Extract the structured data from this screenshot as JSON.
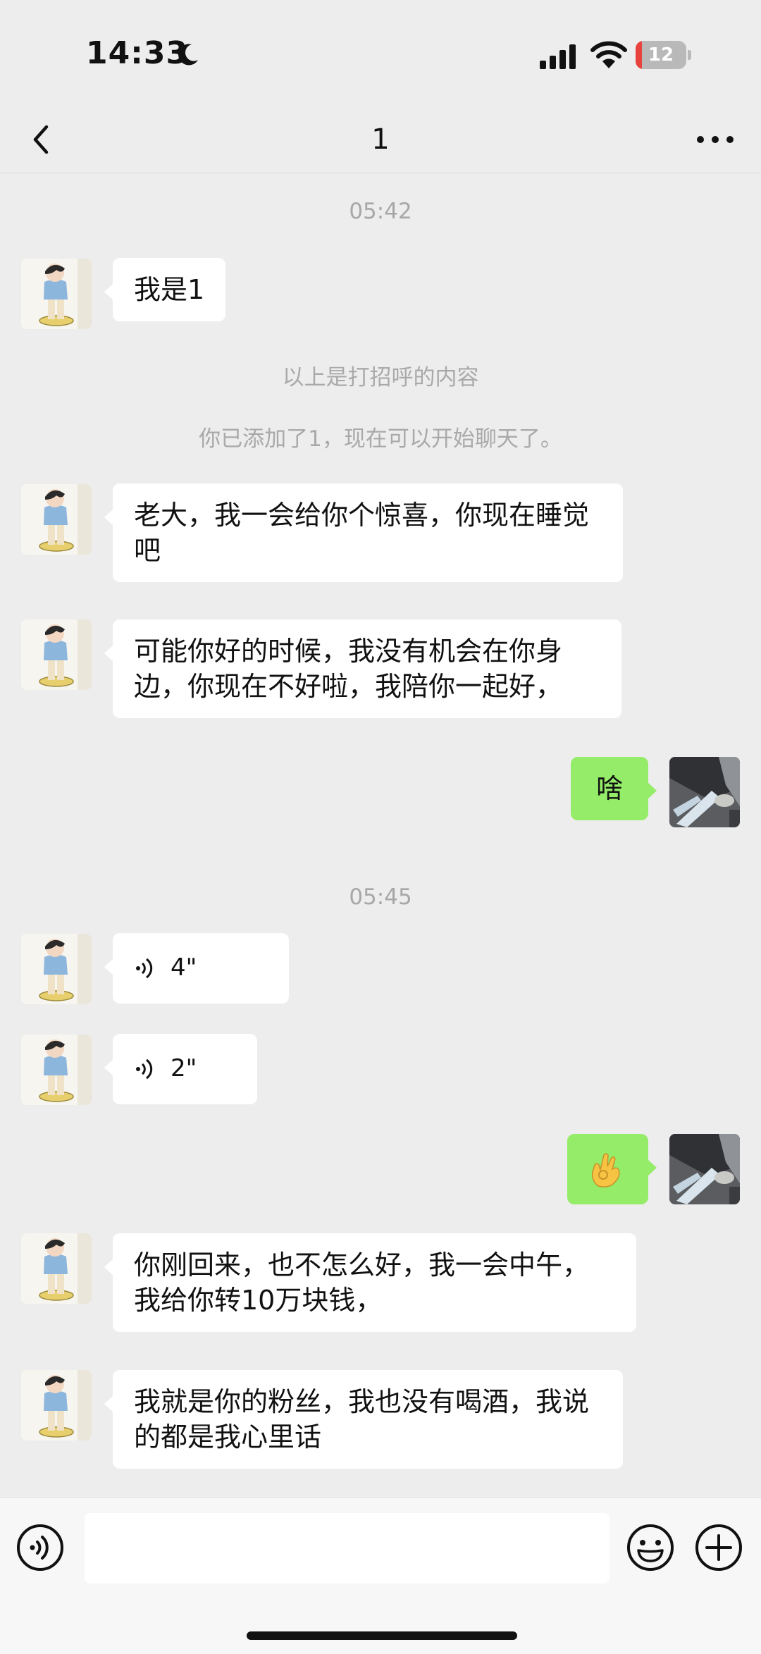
{
  "status_bar": {
    "time": "14:33",
    "battery": "12",
    "battery_level": 0.12
  },
  "nav": {
    "title": "1"
  },
  "chat": {
    "time_1": "05:42",
    "msg_1": "我是1",
    "note_1": "以上是打招呼的内容",
    "note_2": "你已添加了1，现在可以开始聊天了。",
    "msg_2": "老大，我一会给你个惊喜，你现在睡觉吧",
    "msg_3": "可能你好的时候，我没有机会在你身边，你现在不好啦，我陪你一起好，",
    "reply_1": "啥",
    "time_2": "05:45",
    "voice_1": "4\"",
    "voice_2": "2\"",
    "reply_2_icon": "ok-hand-emoji",
    "msg_4": "你刚回来，也不怎么好，我一会中午，我给你转10万块钱，",
    "msg_5": "我就是你的粉丝，我也没有喝酒，我说的都是我心里话"
  },
  "input": {
    "value": ""
  },
  "colors": {
    "background": "#ededed",
    "outgoing_bubble": "#95ec69",
    "incoming_bubble": "#ffffff",
    "battery_low": "#e8423c"
  }
}
